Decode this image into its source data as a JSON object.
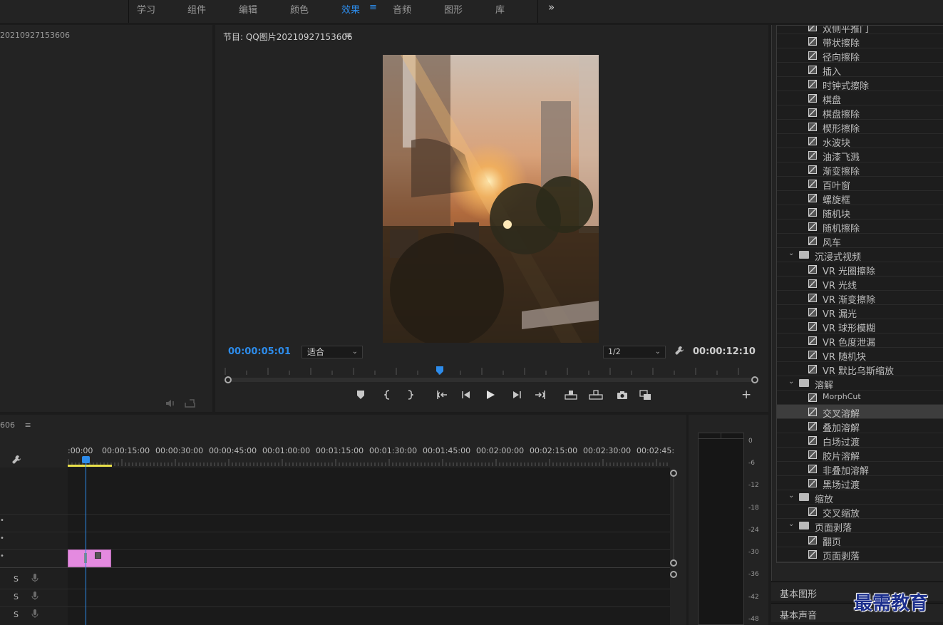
{
  "workspace_tabs": [
    {
      "label": "学习"
    },
    {
      "label": "组件"
    },
    {
      "label": "编辑"
    },
    {
      "label": "颜色"
    },
    {
      "label": "效果",
      "active": true
    },
    {
      "label": "音频"
    },
    {
      "label": "图形"
    },
    {
      "label": "库"
    }
  ],
  "workspace_menu_icon": "≡",
  "workspace_more": "»",
  "source": {
    "title": "20210927153606",
    "icons": [
      "audio-icon",
      "export-icon"
    ]
  },
  "program": {
    "title": "节目: QQ图片20210927153606",
    "menu_icon": "≡",
    "timecode_current": "00:00:05:01",
    "fit_label": "适合",
    "resolution_label": "1/2",
    "timecode_duration": "00:00:12:10",
    "playhead_fraction": 0.4
  },
  "timeline": {
    "title": "606",
    "menu_icon": "≡",
    "ruler_labels": [
      ":00:00",
      "00:00:15:00",
      "00:00:30:00",
      "00:00:45:00",
      "00:01:00:00",
      "00:01:15:00",
      "00:01:30:00",
      "00:01:45:00",
      "00:02:00:00",
      "00:02:15:00",
      "00:02:30:00",
      "00:02:45:"
    ],
    "track_s_label": "S"
  },
  "audio_meter": {
    "db_labels": [
      "0",
      "-6",
      "-12",
      "-18",
      "-24",
      "-30",
      "-36",
      "-42",
      "-48"
    ]
  },
  "effects": {
    "items": [
      {
        "type": "effect",
        "label": "双侧平推门",
        "indent": 1
      },
      {
        "type": "effect",
        "label": "带状擦除",
        "indent": 1
      },
      {
        "type": "effect",
        "label": "径向擦除",
        "indent": 1
      },
      {
        "type": "effect",
        "label": "插入",
        "indent": 1
      },
      {
        "type": "effect",
        "label": "时钟式擦除",
        "indent": 1
      },
      {
        "type": "effect",
        "label": "棋盘",
        "indent": 1
      },
      {
        "type": "effect",
        "label": "棋盘擦除",
        "indent": 1
      },
      {
        "type": "effect",
        "label": "楔形擦除",
        "indent": 1
      },
      {
        "type": "effect",
        "label": "水波块",
        "indent": 1
      },
      {
        "type": "effect",
        "label": "油漆飞溅",
        "indent": 1
      },
      {
        "type": "effect",
        "label": "渐变擦除",
        "indent": 1
      },
      {
        "type": "effect",
        "label": "百叶窗",
        "indent": 1
      },
      {
        "type": "effect",
        "label": "螺旋框",
        "indent": 1
      },
      {
        "type": "effect",
        "label": "随机块",
        "indent": 1
      },
      {
        "type": "effect",
        "label": "随机擦除",
        "indent": 1
      },
      {
        "type": "effect",
        "label": "风车",
        "indent": 1
      },
      {
        "type": "folder",
        "label": "沉浸式视频",
        "indent": 0
      },
      {
        "type": "effect",
        "label": "VR 光圈擦除",
        "indent": 1
      },
      {
        "type": "effect",
        "label": "VR 光线",
        "indent": 1
      },
      {
        "type": "effect",
        "label": "VR 渐变擦除",
        "indent": 1
      },
      {
        "type": "effect",
        "label": "VR 漏光",
        "indent": 1
      },
      {
        "type": "effect",
        "label": "VR 球形模糊",
        "indent": 1
      },
      {
        "type": "effect",
        "label": "VR 色度泄漏",
        "indent": 1
      },
      {
        "type": "effect",
        "label": "VR 随机块",
        "indent": 1
      },
      {
        "type": "effect",
        "label": "VR 默比乌斯缩放",
        "indent": 1
      },
      {
        "type": "folder",
        "label": "溶解",
        "indent": 0
      },
      {
        "type": "effect",
        "label": "MorphCut",
        "indent": 1
      },
      {
        "type": "effect",
        "label": "交叉溶解",
        "indent": 1,
        "selected": true
      },
      {
        "type": "effect",
        "label": "叠加溶解",
        "indent": 1
      },
      {
        "type": "effect",
        "label": "白场过渡",
        "indent": 1
      },
      {
        "type": "effect",
        "label": "胶片溶解",
        "indent": 1
      },
      {
        "type": "effect",
        "label": "非叠加溶解",
        "indent": 1
      },
      {
        "type": "effect",
        "label": "黑场过渡",
        "indent": 1
      },
      {
        "type": "folder",
        "label": "缩放",
        "indent": 0
      },
      {
        "type": "effect",
        "label": "交叉缩放",
        "indent": 1
      },
      {
        "type": "folder",
        "label": "页面剥落",
        "indent": 0
      },
      {
        "type": "effect",
        "label": "翻页",
        "indent": 1
      },
      {
        "type": "effect",
        "label": "页面剥落",
        "indent": 1
      }
    ]
  },
  "side_tabs": [
    {
      "label": "基本图形"
    },
    {
      "label": "基本声音"
    }
  ],
  "watermark": "最需教育",
  "colors": {
    "accent": "#2d8ceb",
    "clip": "#e48ae0",
    "work_area": "#e8e04a",
    "panel_bg": "#232323"
  }
}
